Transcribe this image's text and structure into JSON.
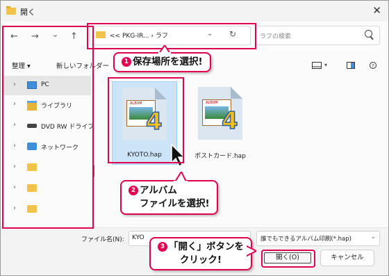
{
  "window": {
    "title": "開く"
  },
  "nav": {
    "back": "←",
    "forward": "→",
    "recent": "⌄",
    "up": "↑",
    "address_text": "<<  PKG-IR...  ›  ラフ",
    "address_chevron": "⌄",
    "refresh": "↻",
    "search_placeholder": "ラフの検索"
  },
  "toolbar": {
    "organize": "整理 ▾",
    "new_folder": "新しいフォルダー"
  },
  "sidebar": {
    "items": [
      {
        "label": "PC"
      },
      {
        "label": "ライブラリ"
      },
      {
        "label": "DVD RW ドライブ"
      },
      {
        "label": "ネットワーク"
      },
      {
        "label": ""
      },
      {
        "label": ""
      },
      {
        "label": ""
      }
    ]
  },
  "files": [
    {
      "name": "KYOTO.hap",
      "album_word": "ALBUM",
      "badge": "4"
    },
    {
      "name": "ポストカード.hap",
      "album_word": "ALBUM",
      "badge": "4"
    }
  ],
  "bottom": {
    "filename_label": "ファイル名(N):",
    "filename_value": "KYO",
    "filetype_value": "誰でもできるアルバム印刷(*.hap)",
    "filetype_chevron": "⌄",
    "open_button": "開く(O)",
    "cancel_button": "キャンセル"
  },
  "callouts": {
    "c1": {
      "num": "1",
      "text": "保存場所を選択!"
    },
    "c2": {
      "num": "2",
      "line1": "アルバム",
      "line2": "ファイルを選択!"
    },
    "c3": {
      "num": "3",
      "line1": "「開く」ボタンを",
      "line2": "クリック!"
    }
  },
  "colors": {
    "accent": "#e0004f",
    "selection": "#cce4f7"
  }
}
